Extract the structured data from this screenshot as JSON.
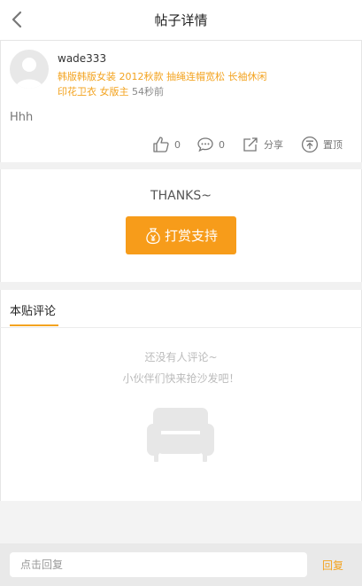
{
  "header": {
    "title": "帖子详情",
    "back_icon": "chevron-left-icon"
  },
  "post": {
    "author": "wade333",
    "tags_line1": "韩版韩版女装 2012秋款 抽绳连帽宽松 长袖休闲",
    "tags_line2": "印花卫衣 女版主",
    "time": "54秒前",
    "content": "Hhh",
    "actions": {
      "like_count": "0",
      "comment_count": "0",
      "share_label": "分享",
      "top_label": "置顶"
    }
  },
  "reward": {
    "thanks_text": "THANKS~",
    "button_label": "打赏支持"
  },
  "comments": {
    "tab_label": "本贴评论",
    "empty_line1": "还没有人评论~",
    "empty_line2": "小伙伴们快来抢沙发吧！"
  },
  "bottom_bar": {
    "input_placeholder": "点击回复",
    "reply_label": "回复"
  },
  "colors": {
    "accent": "#f3a31f",
    "reward_button": "#f79c1a",
    "separator": "#f1f1f1"
  }
}
